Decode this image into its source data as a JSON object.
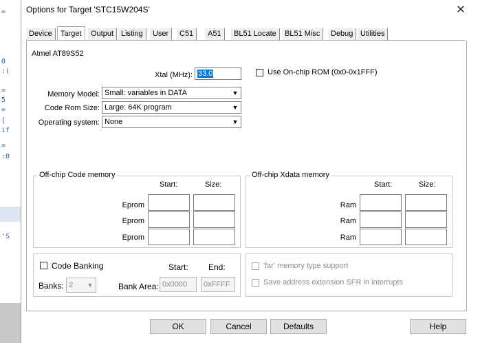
{
  "background": {
    "strip_glyphs": [
      "=",
      "0",
      ":(",
      "=",
      "5",
      "=",
      "[",
      "if",
      "=",
      ":0",
      "'S"
    ]
  },
  "window": {
    "title": "Options for Target 'STC15W204S'",
    "close_glyph": "✕"
  },
  "tabs": [
    {
      "label": "Device"
    },
    {
      "label": "Target",
      "active": true
    },
    {
      "label": "Output"
    },
    {
      "label": "Listing"
    },
    {
      "label": "User"
    },
    {
      "label": "C51"
    },
    {
      "label": "A51"
    },
    {
      "label": "BL51 Locate"
    },
    {
      "label": "BL51 Misc"
    },
    {
      "label": "Debug"
    },
    {
      "label": "Utilities"
    }
  ],
  "target": {
    "device_name": "Atmel AT89S52",
    "xtal_label": "Xtal (MHz):",
    "xtal_value": "33.0",
    "onchip_rom_label": "Use On-chip ROM (0x0-0x1FFF)",
    "onchip_rom_checked": false,
    "memory_model_label": "Memory Model:",
    "memory_model_value": "Small: variables in DATA",
    "code_rom_label": "Code Rom Size:",
    "code_rom_value": "Large: 64K program",
    "os_label": "Operating system:",
    "os_value": "None"
  },
  "offchip_code": {
    "title": "Off-chip Code memory",
    "start_header": "Start:",
    "size_header": "Size:",
    "rows": [
      {
        "label": "Eprom",
        "start": "",
        "size": ""
      },
      {
        "label": "Eprom",
        "start": "",
        "size": ""
      },
      {
        "label": "Eprom",
        "start": "",
        "size": ""
      }
    ]
  },
  "offchip_xdata": {
    "title": "Off-chip Xdata memory",
    "start_header": "Start:",
    "size_header": "Size:",
    "rows": [
      {
        "label": "Ram",
        "start": "",
        "size": ""
      },
      {
        "label": "Ram",
        "start": "",
        "size": ""
      },
      {
        "label": "Ram",
        "start": "",
        "size": ""
      }
    ]
  },
  "banking": {
    "code_banking_label": "Code Banking",
    "start_header": "Start:",
    "end_header": "End:",
    "banks_label": "Banks:",
    "banks_value": "2",
    "bank_area_label": "Bank Area:",
    "bank_area_start": "0x0000",
    "bank_area_end": "0xFFFF"
  },
  "options": {
    "far_memory_label": "'far' memory type support",
    "save_sfr_label": "Save address extension SFR in interrupts"
  },
  "buttons": {
    "ok": "OK",
    "cancel": "Cancel",
    "defaults": "Defaults",
    "help": "Help"
  },
  "colors": {
    "selection": "#0078d7",
    "disabled_text": "#8c8c8c"
  }
}
